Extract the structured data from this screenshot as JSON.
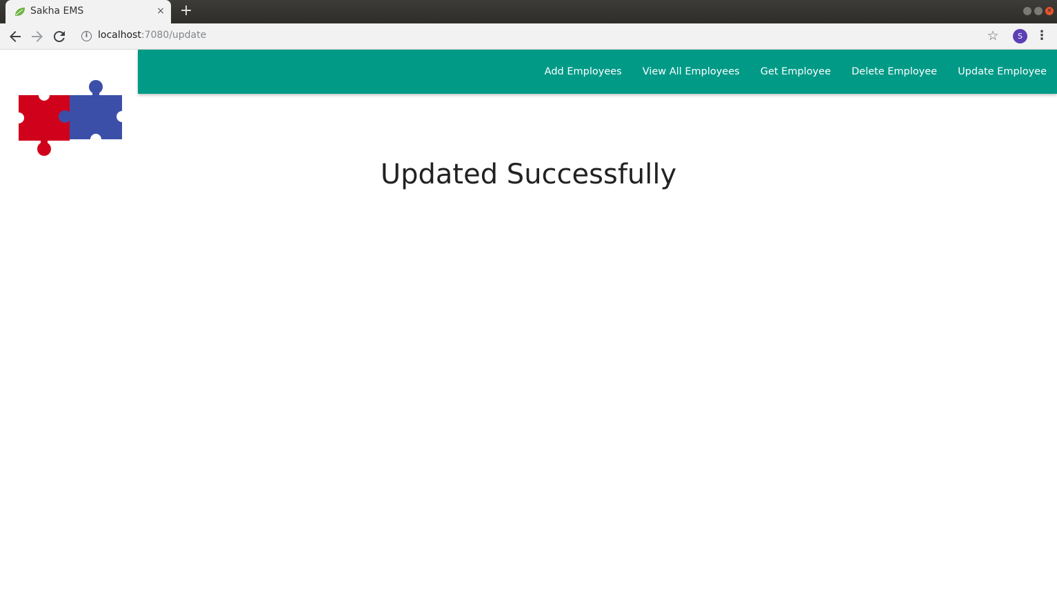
{
  "browser": {
    "tab_title": "Sakha EMS",
    "tab_close": "×",
    "new_tab": "+",
    "url_host": "localhost",
    "url_path": ":7080/update",
    "profile_initial": "S"
  },
  "navbar": {
    "links": [
      "Add Employees",
      "View All Employees",
      "Get Employee",
      "Delete Employee",
      "Update Employee"
    ]
  },
  "main": {
    "heading": "Updated Successfully"
  },
  "colors": {
    "navbar": "#009a87",
    "puzzle_red": "#d0021b",
    "puzzle_blue": "#3b4fa8"
  }
}
